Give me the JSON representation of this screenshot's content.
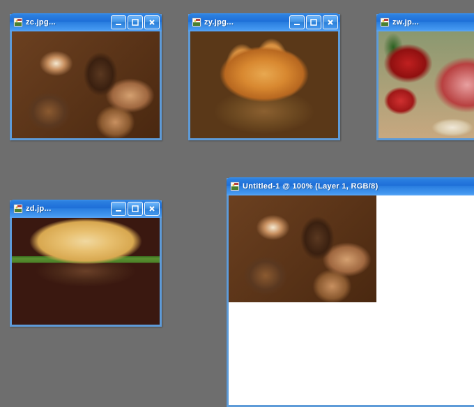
{
  "windows": {
    "zc": {
      "title": "zc.jpg..."
    },
    "zy": {
      "title": "zy.jpg..."
    },
    "zw": {
      "title": "zw.jp..."
    },
    "zd": {
      "title": "zd.jp..."
    },
    "untitled": {
      "title": "Untitled-1 @ 100% (Layer 1, RGB/8)"
    }
  },
  "icons": {
    "file": "image-file-icon",
    "minimize": "minimize-icon",
    "maximize": "maximize-icon",
    "close": "close-icon"
  }
}
